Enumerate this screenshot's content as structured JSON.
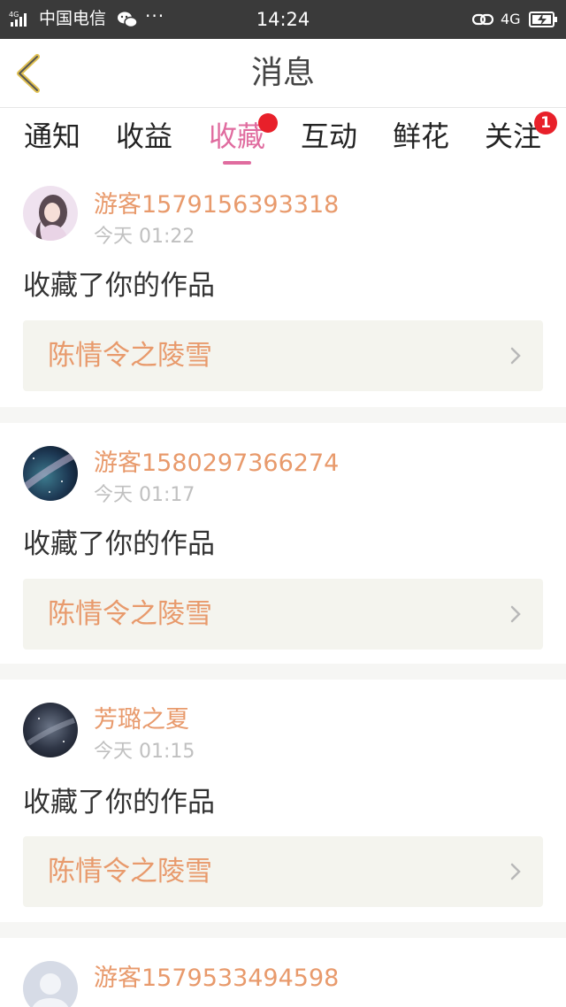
{
  "status_bar": {
    "carrier": "中国电信",
    "dots": "···",
    "time": "14:24",
    "network": "4G",
    "signal_label": "4G"
  },
  "header": {
    "title": "消息",
    "back_icon": "chevron-left-icon"
  },
  "tabs": [
    {
      "label": "通知",
      "active": false,
      "badge": null
    },
    {
      "label": "收益",
      "active": false,
      "badge": null
    },
    {
      "label": "收藏",
      "active": true,
      "badge": "dot"
    },
    {
      "label": "互动",
      "active": false,
      "badge": null
    },
    {
      "label": "鲜花",
      "active": false,
      "badge": null
    },
    {
      "label": "关注",
      "active": false,
      "badge": "1"
    }
  ],
  "notifications": [
    {
      "username": "游客1579156393318",
      "time": "今天 01:22",
      "action": "收藏了你的作品",
      "work": "陈情令之陵雪",
      "avatar": "girl-portrait"
    },
    {
      "username": "游客1580297366274",
      "time": "今天 01:17",
      "action": "收藏了你的作品",
      "work": "陈情令之陵雪",
      "avatar": "milky-way"
    },
    {
      "username": "芳璐之夏",
      "time": "今天 01:15",
      "action": "收藏了你的作品",
      "work": "陈情令之陵雪",
      "avatar": "night-sky"
    },
    {
      "username": "游客1579533494598",
      "time": "",
      "action": "",
      "work": "",
      "avatar": "default-user"
    }
  ],
  "colors": {
    "accent_pink": "#e06c9f",
    "username_orange": "#e89a6c",
    "badge_red": "#e8202a",
    "work_box_bg": "#f4f4ee",
    "status_bar_bg": "#3a3a3a"
  }
}
